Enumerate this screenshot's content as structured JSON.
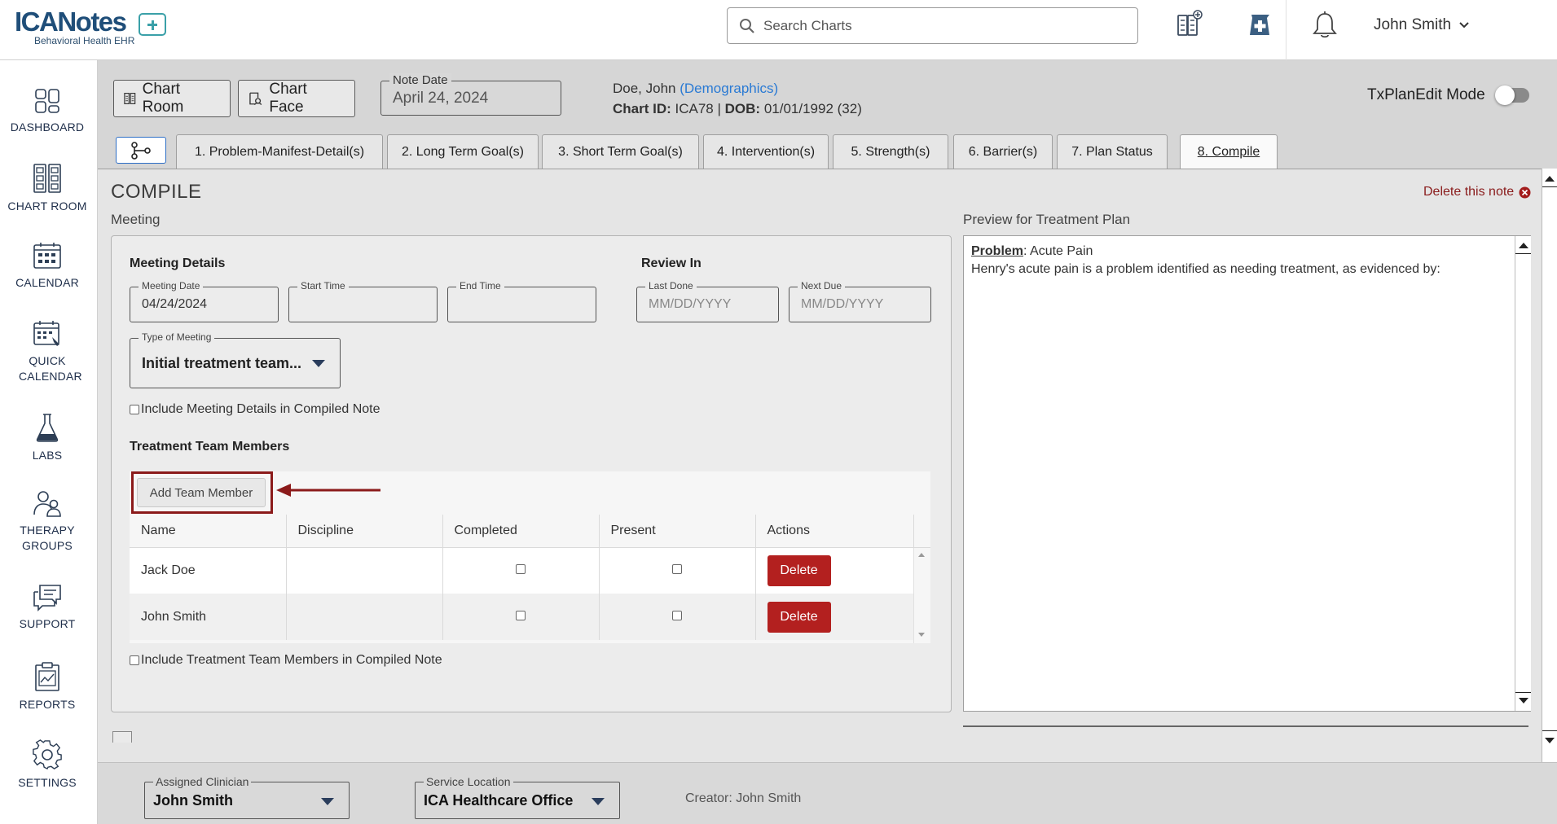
{
  "app": {
    "logo_text": "ICANotes",
    "logo_subtitle": "Behavioral Health EHR"
  },
  "header": {
    "search_placeholder": "Search Charts",
    "user_name": "John Smith",
    "icons": [
      "chart-cabinet-add-icon",
      "medical-bag-icon",
      "bell-icon"
    ]
  },
  "sidebar": {
    "items": [
      {
        "label": "DASHBOARD",
        "icon": "dashboard-icon"
      },
      {
        "label": "CHART ROOM",
        "icon": "chart-room-icon"
      },
      {
        "label": "CALENDAR",
        "icon": "calendar-icon"
      },
      {
        "label": "QUICK CALENDAR",
        "icon": "quick-calendar-icon"
      },
      {
        "label": "LABS",
        "icon": "flask-icon"
      },
      {
        "label": "THERAPY GROUPS",
        "icon": "therapy-groups-icon"
      },
      {
        "label": "SUPPORT",
        "icon": "support-icon"
      },
      {
        "label": "REPORTS",
        "icon": "reports-icon"
      },
      {
        "label": "SETTINGS",
        "icon": "gear-icon"
      }
    ]
  },
  "toolbar": {
    "chart_room": "Chart Room",
    "chart_face": "Chart Face",
    "note_date_label": "Note Date",
    "note_date_value": "April 24, 2024"
  },
  "patient": {
    "name": "Doe, John",
    "demographics_link": "(Demographics)",
    "chart_id_label": "Chart ID:",
    "chart_id": "ICA78",
    "dob_label": "DOB:",
    "dob": "01/01/1992 (32)"
  },
  "txplan_mode": {
    "label": "TxPlanEdit Mode",
    "enabled": false
  },
  "tabs": [
    {
      "label": "1. Problem-Manifest-Detail(s)"
    },
    {
      "label": "2. Long Term Goal(s)"
    },
    {
      "label": "3. Short Term Goal(s)"
    },
    {
      "label": "4. Intervention(s)"
    },
    {
      "label": "5. Strength(s)"
    },
    {
      "label": "6. Barrier(s)"
    },
    {
      "label": "7. Plan Status"
    },
    {
      "label": "8. Compile"
    }
  ],
  "compile": {
    "title": "COMPILE",
    "delete_note": "Delete this note",
    "meeting_label": "Meeting",
    "preview_label": "Preview for Treatment Plan"
  },
  "meeting": {
    "details_heading": "Meeting Details",
    "meeting_date_label": "Meeting Date",
    "meeting_date_value": "04/24/2024",
    "start_time_label": "Start Time",
    "start_time_value": "",
    "end_time_label": "End Time",
    "end_time_value": "",
    "review_heading": "Review In",
    "last_done_label": "Last Done",
    "last_done_placeholder": "MM/DD/YYYY",
    "next_due_label": "Next Due",
    "next_due_placeholder": "MM/DD/YYYY",
    "type_label": "Type of Meeting",
    "type_value": "Initial treatment team...",
    "include_details_label": "Include Meeting Details in Compiled Note",
    "team_heading": "Treatment Team Members",
    "add_member_label": "Add Team Member",
    "columns": [
      "Name",
      "Discipline",
      "Completed",
      "Present",
      "Actions"
    ],
    "members": [
      {
        "name": "Jack Doe",
        "discipline": "",
        "completed": false,
        "present": false,
        "action": "Delete"
      },
      {
        "name": "John Smith",
        "discipline": "",
        "completed": false,
        "present": false,
        "action": "Delete"
      }
    ],
    "include_team_label": "Include Treatment Team Members in Compiled Note"
  },
  "preview": {
    "problem_label": "Problem",
    "problem_value": ": Acute Pain",
    "text": "Henry's acute pain is a problem identified as needing treatment, as evidenced by:"
  },
  "footer": {
    "clinician_label": "Assigned Clinician",
    "clinician_value": "John Smith",
    "location_label": "Service Location",
    "location_value": "ICA Healthcare Office",
    "creator": "Creator: John Smith"
  },
  "colors": {
    "brand_navy": "#1f4e79",
    "brand_teal": "#3aa0a8",
    "delete_red": "#b3201f",
    "highlight_border": "#8b1a1a",
    "link_blue": "#2a7ad4"
  }
}
